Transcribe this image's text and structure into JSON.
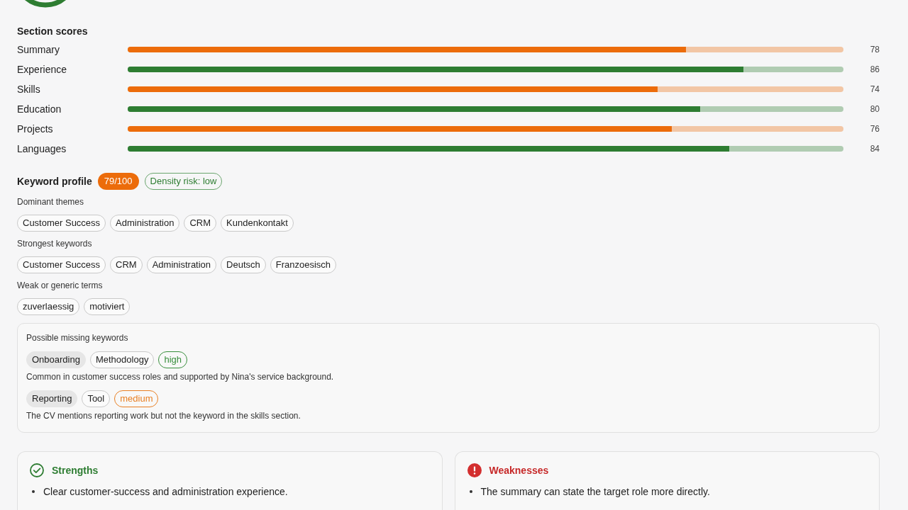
{
  "section_scores": {
    "title": "Section scores",
    "sections": [
      {
        "name": "Summary",
        "level": 0.78,
        "score": "78",
        "color": "#ec6c0b"
      },
      {
        "name": "Experience",
        "level": 0.86,
        "score": "86",
        "color": "#2e7d32"
      },
      {
        "name": "Skills",
        "level": 0.74,
        "score": "74",
        "color": "#ec6c0b"
      },
      {
        "name": "Education",
        "level": 0.8,
        "score": "80",
        "color": "#2e7d32"
      },
      {
        "name": "Projects",
        "level": 0.76,
        "score": "76",
        "color": "#ec6c0b"
      },
      {
        "name": "Languages",
        "level": 0.84,
        "score": "84",
        "color": "#2e7d32"
      }
    ]
  },
  "keyword_profile": {
    "title": "Keyword profile",
    "score": {
      "text": "79/100",
      "kind": "warn"
    },
    "density_risk": {
      "text": "Density risk: low",
      "kind": "good"
    },
    "groups": [
      {
        "title": "Dominant themes",
        "keywords": [
          "Customer Success",
          "Administration",
          "CRM",
          "Kundenkontakt"
        ]
      },
      {
        "title": "Strongest keywords",
        "keywords": [
          "Customer Success",
          "CRM",
          "Administration",
          "Deutsch",
          "Franzoesisch"
        ]
      },
      {
        "title": "Weak or generic terms",
        "keywords": [
          "zuverlaessig",
          "motiviert"
        ]
      }
    ],
    "missing": {
      "title": "Possible missing keywords",
      "items": [
        {
          "keyword": "Onboarding",
          "category": "Methodology",
          "priority": "high",
          "color": "#388e3c",
          "note": "Common in customer success roles and supported by Nina's service background."
        },
        {
          "keyword": "Reporting",
          "category": "Tool",
          "priority": "medium",
          "color": "#e87f22",
          "note": "The CV mentions reporting work but not the keyword in the skills section."
        }
      ]
    }
  },
  "findings": [
    {
      "kind": "strengths",
      "title": "Strengths",
      "items": [
        "Clear customer-success and administration experience."
      ]
    },
    {
      "kind": "weaknesses",
      "title": "Weaknesses",
      "items": [
        "The summary can state the target role more directly."
      ]
    }
  ]
}
